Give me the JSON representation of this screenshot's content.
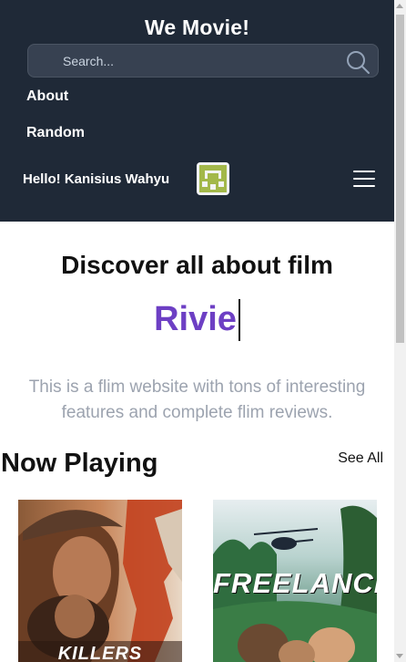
{
  "header": {
    "brand": "We Movie!",
    "search_placeholder": "Search...",
    "nav": [
      {
        "label": "About"
      },
      {
        "label": "Random"
      }
    ],
    "greeting": "Hello! Kanisius Wahyu"
  },
  "hero": {
    "title": "Discover all about film",
    "typed_text": "Rivie",
    "description": "This is a flim website with tons of interesting features and complete flim reviews."
  },
  "now_playing": {
    "title": "Now Playing",
    "see_all": "See All",
    "movies": [
      {
        "poster_text": "KILLERS"
      },
      {
        "poster_text": "FREELANCE"
      }
    ]
  },
  "colors": {
    "header_bg": "#1f2937",
    "accent_purple": "#6d3fc4",
    "muted_text": "#9ca3af"
  }
}
